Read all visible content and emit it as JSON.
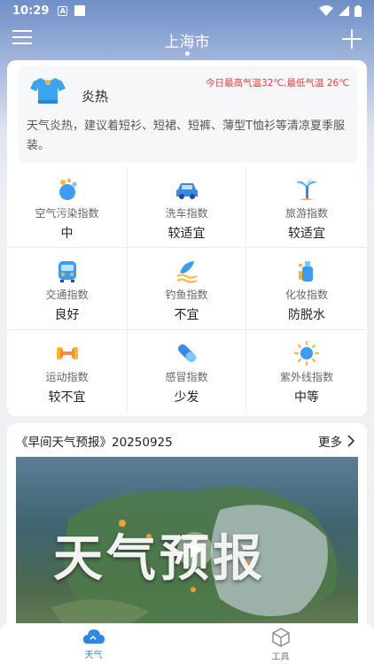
{
  "status_bar": {
    "time": "10:29",
    "notif_letter": "A"
  },
  "header": {
    "city": "上海市"
  },
  "dress": {
    "title": "炎热",
    "temp_range": "今日最高气温32℃,最低气温 26℃",
    "description": "天气炎热，建议着短衫、短裙、短裤、薄型T恤衫等清凉夏季服装。"
  },
  "indices": [
    {
      "label": "空气污染指数",
      "value": "中",
      "icon": "air-pollution-icon"
    },
    {
      "label": "洗车指数",
      "value": "较适宜",
      "icon": "car-wash-icon"
    },
    {
      "label": "旅游指数",
      "value": "较适宜",
      "icon": "travel-icon"
    },
    {
      "label": "交通指数",
      "value": "良好",
      "icon": "traffic-icon"
    },
    {
      "label": "钓鱼指数",
      "value": "不宜",
      "icon": "fishing-icon"
    },
    {
      "label": "化妆指数",
      "value": "防脱水",
      "icon": "makeup-icon"
    },
    {
      "label": "运动指数",
      "value": "较不宜",
      "icon": "sport-icon"
    },
    {
      "label": "感冒指数",
      "value": "少发",
      "icon": "cold-icon"
    },
    {
      "label": "紫外线指数",
      "value": "中等",
      "icon": "uv-icon"
    }
  ],
  "video": {
    "title": "《早间天气预报》20250925",
    "more_label": "更多",
    "overlay_text": "天气预报"
  },
  "nav": [
    {
      "label": "天气",
      "active": true,
      "icon": "weather-cloud-icon"
    },
    {
      "label": "工具",
      "active": false,
      "icon": "tools-cube-icon"
    }
  ],
  "colors": {
    "accent": "#2f86e6",
    "temp_red": "#e0413d",
    "header_blue": "#6f8fc8"
  }
}
